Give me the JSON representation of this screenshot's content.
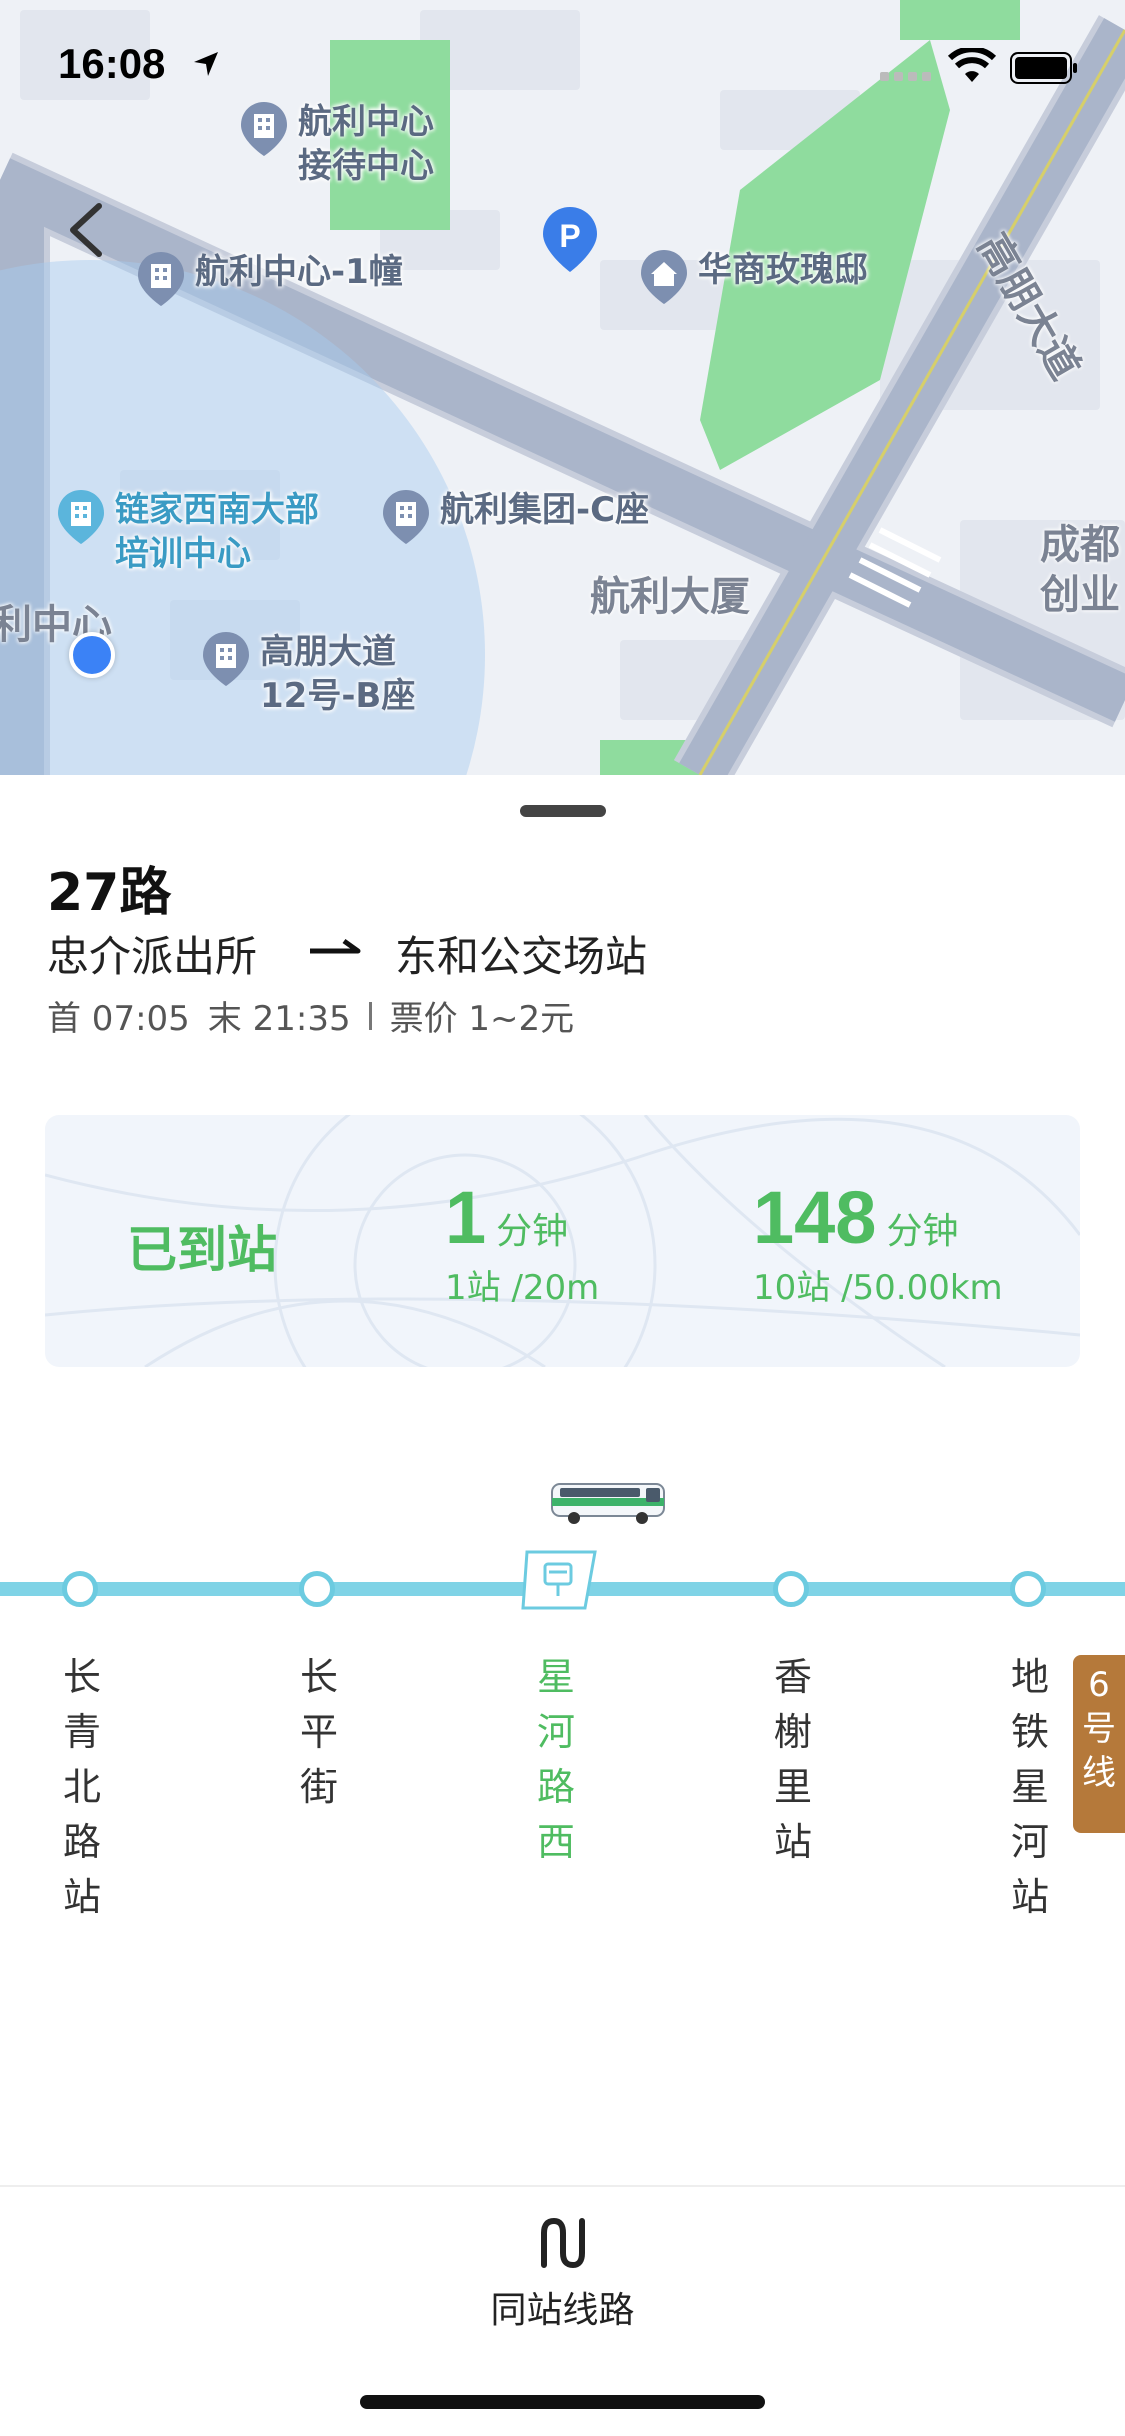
{
  "status_bar": {
    "time": "16:08",
    "icons": [
      "location-arrow-icon",
      "cellular-signal-icon",
      "wifi-icon",
      "battery-icon"
    ]
  },
  "map": {
    "pois": [
      {
        "label": "航利中心\n接待中心",
        "icon": "building-icon"
      },
      {
        "label": "航利中心-1幢",
        "icon": "building-icon"
      },
      {
        "label": "华商玫瑰邸",
        "icon": "residential-icon"
      },
      {
        "label": "链家西南大部\n培训中心",
        "icon": "building-icon"
      },
      {
        "label": "航利集团-C座",
        "icon": "building-icon"
      },
      {
        "label": "高朋大道\n12号-B座",
        "icon": "building-icon"
      }
    ],
    "labels": {
      "road": "高朋大道",
      "building": "航利大厦",
      "edge_right": "成都\n创业",
      "edge_left": "利中心"
    },
    "parking": "P"
  },
  "route": {
    "name": "27路",
    "from": "忠介派出所",
    "to": "东和公交场站",
    "first_bus": "首 07:05",
    "last_bus": "末 21:35",
    "fare": "票价 1~2元"
  },
  "eta": {
    "status": "已到站",
    "next": {
      "value": "1",
      "unit": "分钟",
      "detail": "1站 /20m"
    },
    "following": {
      "value": "148",
      "unit": "分钟",
      "detail": "10站 /50.00km"
    }
  },
  "stops": [
    {
      "name": "长\n青\n北\n路\n站",
      "current": false
    },
    {
      "name": "长\n平\n街",
      "current": false
    },
    {
      "name": "星\n河\n路\n西",
      "current": true
    },
    {
      "name": "香\n榭\n里\n站",
      "current": false
    },
    {
      "name": "地\n铁\n星\n河\n站",
      "current": false
    }
  ],
  "metro_badge": "6\n号\n线",
  "bottom": {
    "same_station_label": "同站线路"
  },
  "colors": {
    "accent_green": "#4fbc61",
    "route_line": "#7fd3e6",
    "metro_badge": "#b5793a"
  }
}
